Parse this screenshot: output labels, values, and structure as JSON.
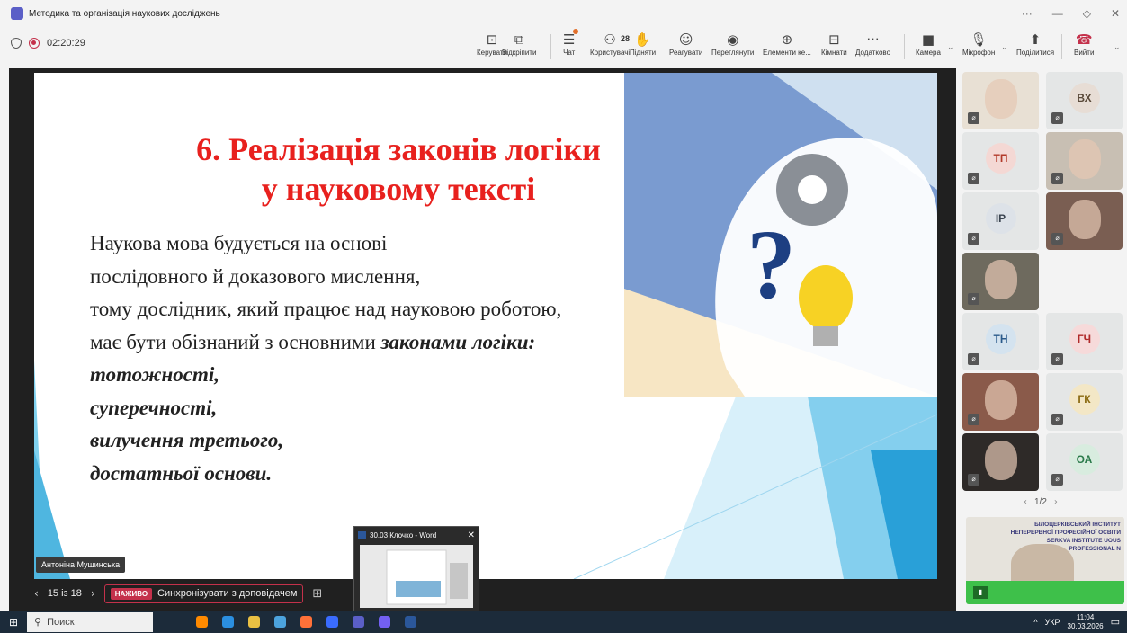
{
  "window": {
    "title": "Методика та організація наукових досліджень",
    "more": "···",
    "min": "—",
    "restore": "◇",
    "close": "✕"
  },
  "meeting": {
    "timer": "02:20:29"
  },
  "toolbar": {
    "buttons": [
      {
        "icon": "manage-icon",
        "glyph": "⊡",
        "label": "Керувати"
      },
      {
        "icon": "popout-icon",
        "glyph": "⧉",
        "label": "Відкріпити"
      },
      {
        "icon": "chat-icon",
        "glyph": "☰",
        "label": "Чат"
      },
      {
        "icon": "people-icon",
        "glyph": "⚇",
        "label": "Користувачі",
        "count": "28"
      },
      {
        "icon": "raise-hand-icon",
        "glyph": "✋",
        "label": "Підняти"
      },
      {
        "icon": "react-icon",
        "glyph": "☺",
        "label": "Реагувати"
      },
      {
        "icon": "view-icon",
        "glyph": "◉",
        "label": "Переглянути"
      },
      {
        "icon": "apps-icon",
        "glyph": "⊕",
        "label": "Елементи ке..."
      },
      {
        "icon": "rooms-icon",
        "glyph": "⊟",
        "label": "Кімнати"
      },
      {
        "icon": "more-icon",
        "glyph": "···",
        "label": "Додатково"
      },
      {
        "icon": "camera-icon",
        "glyph": "■",
        "label": "Камера"
      },
      {
        "icon": "mic-icon",
        "glyph": "🎙",
        "label": "Мікрофон"
      },
      {
        "icon": "share-icon",
        "glyph": "⬆",
        "label": "Поділитися"
      },
      {
        "icon": "leave-icon",
        "glyph": "☎",
        "label": "Вийти"
      }
    ]
  },
  "slide": {
    "title_line1": "6. Реалізація законів логіки",
    "title_line2": "у науковому тексті",
    "body_lines": [
      "Наукова мова будується на основі",
      "послідовного й доказового мислення,",
      "тому дослідник, який працює над науковою роботою,"
    ],
    "line4_plain": "має бути обізнаний з основними ",
    "line4_bold": "законами логіки:",
    "laws": [
      "тотожності,",
      "суперечності,",
      "вилучення третього,",
      "достатньої основи."
    ]
  },
  "presenter": {
    "name": "Антоніна Мушинська"
  },
  "nav": {
    "prev": "‹",
    "page": "15 із 18",
    "next": "›",
    "live": "НАЖИВО",
    "sync": "Синхронізувати з доповідачем",
    "grid": "⊞"
  },
  "word_preview": {
    "title": "30.03 Клочко - Word",
    "close": "✕"
  },
  "participants": [
    {
      "initials": "",
      "type": "photo",
      "bg": "#e8e0d4"
    },
    {
      "initials": "ВХ",
      "type": "avatar",
      "bg": "#e7ddd5",
      "color": "#5a4a3a"
    },
    {
      "initials": "ТП",
      "type": "avatar",
      "bg": "#f4d8d4",
      "color": "#b23a2a"
    },
    {
      "initials": "",
      "type": "photo",
      "bg": "#c8bfb3"
    },
    {
      "initials": "ІР",
      "type": "avatar",
      "bg": "#dde2e8",
      "color": "#3a4450"
    },
    {
      "initials": "",
      "type": "photo",
      "bg": "#7a5e52"
    },
    {
      "initials": "",
      "type": "photo",
      "bg": "#6e6a5e"
    },
    {
      "initials": "",
      "type": "empty",
      "bg": "#e4e6e6"
    },
    {
      "initials": "ТН",
      "type": "avatar",
      "bg": "#d4e3ef",
      "color": "#2a5a8a"
    },
    {
      "initials": "ГЧ",
      "type": "avatar",
      "bg": "#f6dada",
      "color": "#b02a2a"
    },
    {
      "initials": "",
      "type": "photo",
      "bg": "#8a5a4a"
    },
    {
      "initials": "ГК",
      "type": "avatar",
      "bg": "#f3e7c6",
      "color": "#8a6a10"
    },
    {
      "initials": "",
      "type": "photo",
      "bg": "#2e2a28"
    },
    {
      "initials": "ОА",
      "type": "avatar",
      "bg": "#d8ecdf",
      "color": "#2a7a4a"
    }
  ],
  "pager": {
    "prev": "‹",
    "text": "1/2",
    "next": "›"
  },
  "share_tile": {
    "institute": "БІЛОЦЕРКІВСЬКИЙ ІНСТИТУТ НЕПЕРЕРВНОЇ ПРОФЕСІЙНОЇ ОСВІТИ",
    "institute_en": "SERKVA INSTITUTE UOUS PROFESSIONAL N",
    "meter": "▮"
  },
  "taskbar": {
    "start": "⊞",
    "search_placeholder": "Поиск",
    "tray": "^",
    "lang": "УКР",
    "time": "11:04",
    "date": "30.03.2026",
    "apps": [
      "#ff8a00",
      "#2b8fe0",
      "#e9c043",
      "#4ca3dd",
      "#ff7139",
      "#3a6cff",
      "#5b5fc7",
      "#7360f2",
      "#2b579a"
    ]
  },
  "colors": {
    "title_red": "#e8211e",
    "teams_purple": "#5b5fc7",
    "live_red": "#c4314b",
    "green": "#3ec04a"
  }
}
